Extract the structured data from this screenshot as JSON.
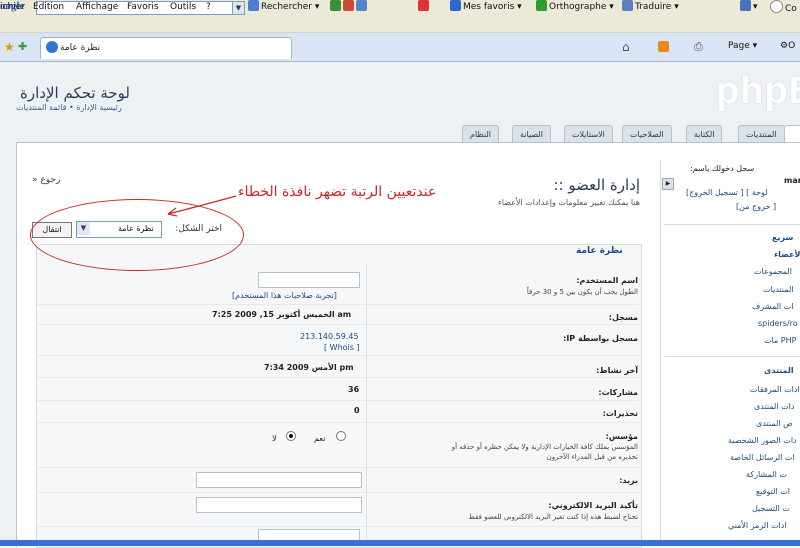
{
  "browser": {
    "toolbar": {
      "logo_text": "oogle",
      "search_label": "Rechercher",
      "favorites_label": "Mes favoris",
      "spellcheck_label": "Orthographe",
      "translate_label": "Traduire",
      "account_label": "Co"
    },
    "menu": [
      "ichier",
      "Edition",
      "Affichage",
      "Favoris",
      "Outils",
      "?"
    ],
    "tab_title": "نظرة عامة",
    "page_menu_label": "Page",
    "tools_label": "O"
  },
  "header": {
    "title": "لوحة تحكم الإدارة",
    "breadcrumb": "رئيسية الإدارة • قائمة المنتديات",
    "logo_text": "phpB"
  },
  "nav_tabs": [
    "المنتديات",
    "الكتابة",
    "الصلاحيات",
    "الاستايلات",
    "الصيانة",
    "النظام"
  ],
  "sidebar": {
    "login_line": "سجل دخولك باسم:",
    "username": "mar",
    "logout_links": "[تسجيل الخروج ] [ لوحة",
    "logout_links2": "[خروج من ]",
    "quick_head": "سريع",
    "members_head": "الأعضاء",
    "quick_items": [
      "المجموعات",
      "المنتديات",
      "ات المشرف",
      "spiders/ro",
      "مات PHP"
    ],
    "forum_head": "المنتدى",
    "forum_items": [
      "ادات المرفقات",
      "دات المنتدى",
      "ض المنتدى",
      "دات الصور الشخصية",
      "ات الرسائل الخاصة",
      "ت المشاركة",
      "ات التوقيع",
      "ت التسجيل",
      "ادات الرمز الأمني"
    ]
  },
  "main": {
    "back": "» رجوع",
    "title": "إدارة العضو ::",
    "description": "هنا يمكنك تغيير معلومات وإعدادات الأعضاء",
    "select_label": "اختر الشكل:",
    "select_value": "نظرة عامة",
    "go_button": "انتقال",
    "legend": "نظرة عامة"
  },
  "annotation": {
    "text": "عندتعيين الرتبة تضهر نافذة الخطاء"
  },
  "form": {
    "username_label": "اسم المستخدم:",
    "username_hint": "الطول يجب أن يكون بين 5 و 30 حرفاً",
    "test_permissions": "[تجربة صلاحيات هذا المستخدم]",
    "registered_label": "مسجل:",
    "registered_value": "الخميس أكتوبر 15, 2009 7:25 am",
    "reg_ip_label": "مسجل بواسطة IP:",
    "reg_ip_value": "213.140.59.45",
    "whois": "[ Whois ]",
    "last_active_label": "آخر نشاط:",
    "last_active_value": "الأمس 2009 7:34 pm",
    "posts_label": "مشاركات:",
    "posts_value": "36",
    "warnings_label": "تحذيرات:",
    "warnings_value": "0",
    "founder_label": "مؤسس:",
    "founder_hint1": "المؤسس يملك كافة الخيارات الإدارية ولا يمكن حظره أو حذفه أو",
    "founder_hint2": "تحذيره من قبل المدراء الآخرون",
    "yes": "نعم",
    "no": "لا",
    "email_label": "بريد:",
    "email_confirm_label": "تأكيد البريد الالكتروني:",
    "email_confirm_hint": "تحتاج لضبط هذه إذا كنت تغير البريد الالكتروني للعضو فقط"
  }
}
